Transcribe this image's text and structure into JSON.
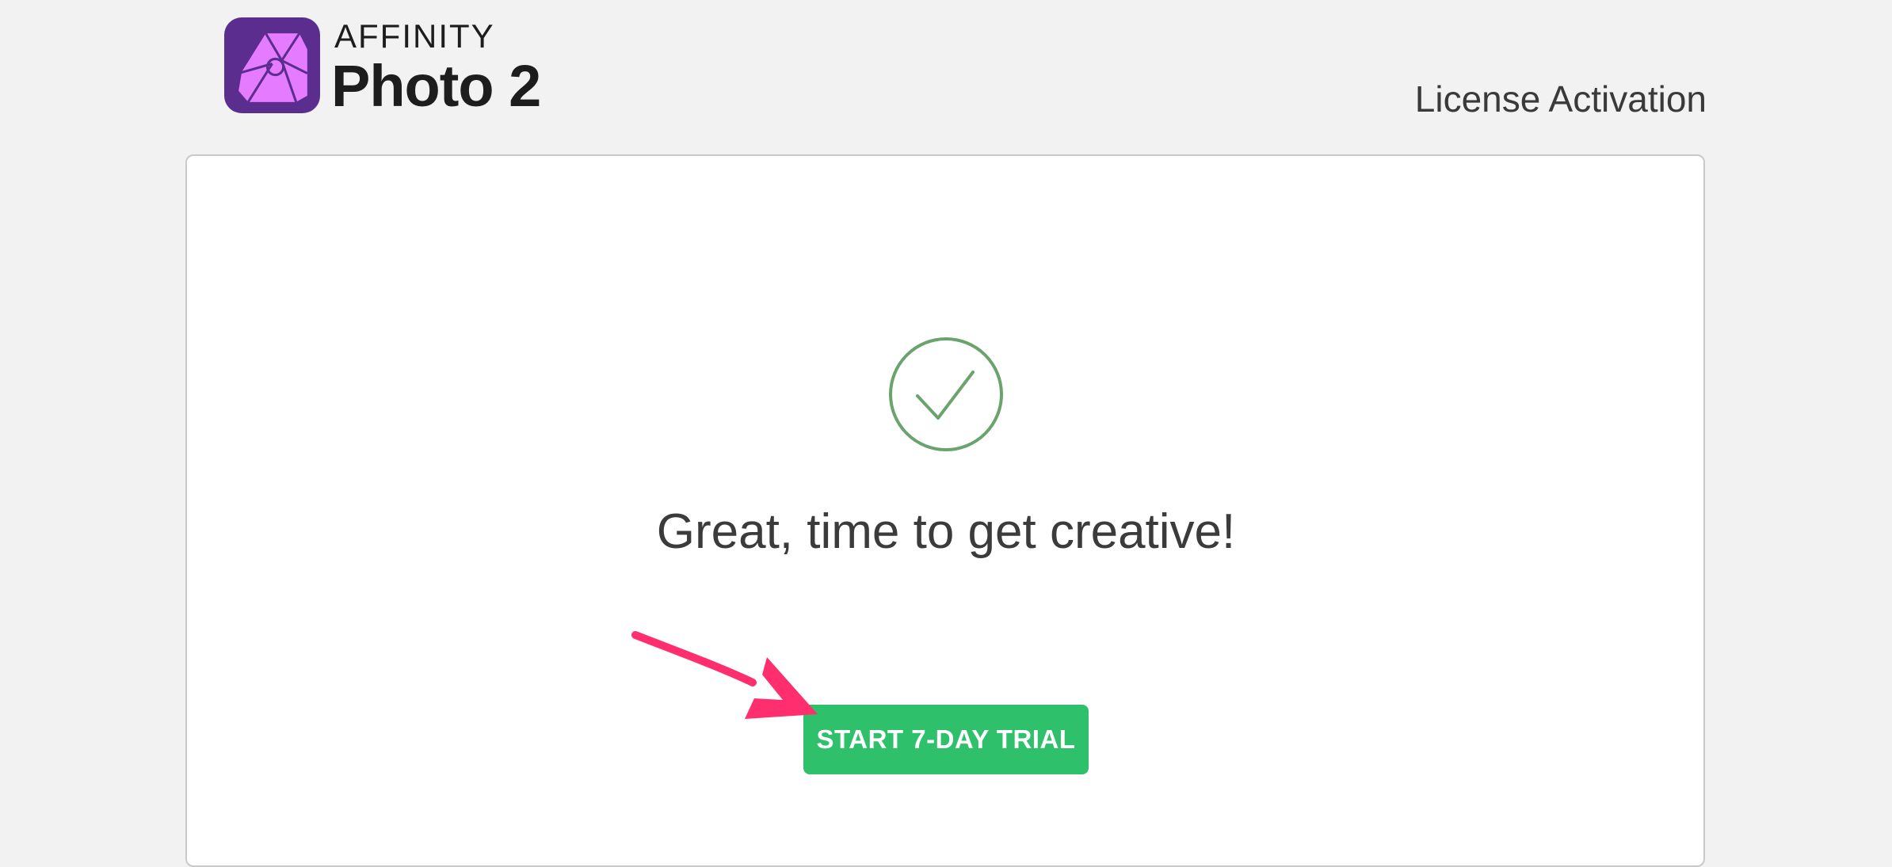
{
  "header": {
    "brand": "AFFINITY",
    "product": "Photo 2",
    "page_title": "License Activation"
  },
  "main": {
    "message": "Great, time to get creative!",
    "cta_label": "START 7-DAY TRIAL"
  },
  "icons": {
    "app_logo": "affinity-photo-logo-icon",
    "success": "checkmark-circle-icon",
    "annotation": "pointer-arrow-icon"
  },
  "colors": {
    "logo_purple": "#5a2d8f",
    "logo_pink": "#e57bff",
    "success_green": "#6aa36c",
    "cta_green": "#2ec06a",
    "arrow_pink": "#ff2f6f"
  }
}
